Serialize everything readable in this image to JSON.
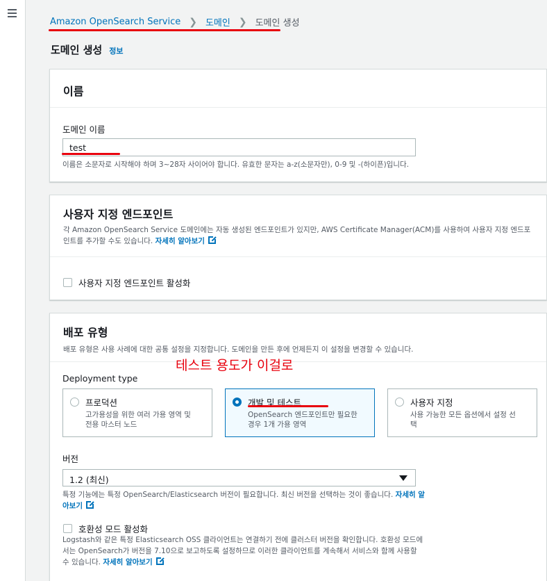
{
  "breadcrumb": {
    "items": [
      "Amazon OpenSearch Service",
      "도메인",
      "도메인 생성"
    ]
  },
  "page": {
    "title": "도메인 생성",
    "info_link": "정보"
  },
  "name_panel": {
    "title": "이름",
    "field_label": "도메인 이름",
    "field_value": "test",
    "hint": "이름은 소문자로 시작해야 하며 3~28자 사이어야 합니다. 유효한 문자는 a-z(소문자만), 0-9 및 -(하이픈)입니다."
  },
  "endpoint_panel": {
    "title": "사용자 지정 엔드포인트",
    "desc": "각 Amazon OpenSearch Service 도메인에는 자동 생성된 엔드포인트가 있지만, AWS Certificate Manager(ACM)를 사용하여 사용자 지정 엔드포",
    "desc2": "인트를 추가할 수도 있습니다.",
    "learn_more": "자세히 알아보기",
    "checkbox_label": "사용자 지정 엔드포인트 활성화"
  },
  "deploy_panel": {
    "title": "배포 유형",
    "desc": "배포 유형은 사용 사례에 대한 공통 설정을 지정합니다. 도메인을 만든 후에 언제든지 이 설정을 변경할 수 있습니다.",
    "deployment_type_label": "Deployment type",
    "options": [
      {
        "title": "프로덕션",
        "desc1": "고가용성을 위한 여러 가용 영역 및",
        "desc2": "전용 마스터 노드"
      },
      {
        "title": "개발 및 테스트",
        "desc1": "OpenSearch 엔드포인트만 필요한",
        "desc2": "경우 1개 가용 영역"
      },
      {
        "title": "사용자 지정",
        "desc1": "사용 가능한 모든 옵션에서 설정 선",
        "desc2": "택"
      }
    ],
    "selected_option": "개발 및 테스트",
    "version_label": "버전",
    "version_value": "1.2 (최신)",
    "version_hint": "특정 기능에는 특정 OpenSearch/Elasticsearch 버전이 필요합니다. 최신 버전을 선택하는 것이 좋습니다.",
    "version_hint_link1": "자세히 알",
    "version_hint_link2": "아보기",
    "compat_label": "호환성 모드 활성화",
    "compat_hint1": "Logstash와 같은 특정 Elasticsearch OSS 클라이언트는 연결하기 전에 클러스터 버전을 확인합니다. 호환성 모드에",
    "compat_hint2": "서는 OpenSearch가 버전을 7.10으로 보고하도록 설정하므로 이러한 클라이언트를 계속해서 서비스와 함께 사용할",
    "compat_hint3": "수 있습니다.",
    "compat_learn_more": "자세히 알아보기"
  },
  "annotation": {
    "text": "테스트 용도가 이걸로",
    "color": "#e8000d"
  },
  "colors": {
    "link": "#0073bb",
    "background": "#f2f3f3",
    "selected_tile": "#f1faff"
  }
}
